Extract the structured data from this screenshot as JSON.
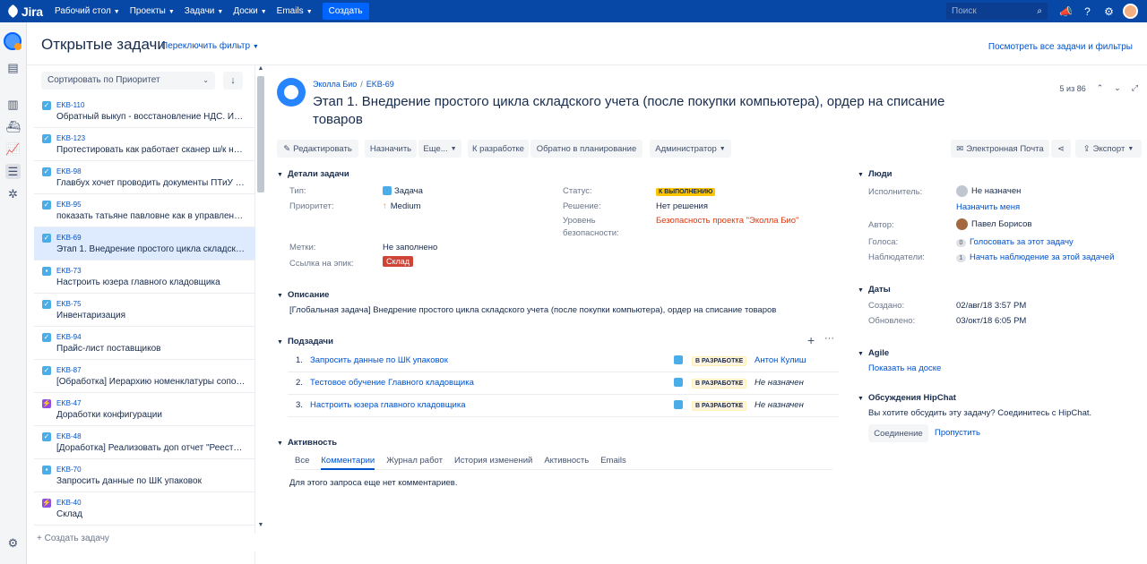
{
  "topnav": {
    "logo": "Jira",
    "items": [
      "Рабочий стол",
      "Проекты",
      "Задачи",
      "Доски",
      "Emails"
    ],
    "create": "Создать",
    "search_placeholder": "Поиск"
  },
  "header": {
    "title": "Открытые задачи",
    "switch_filter": "Переключить фильтр",
    "view_all": "Посмотреть все задачи и фильтры"
  },
  "list": {
    "sort_label": "Сортировать по Приоритет",
    "rows": [
      {
        "key": "EKB-110",
        "summary": "Обратный выкуп - восстановление НДС. Испо...",
        "type": "task"
      },
      {
        "key": "EKB-123",
        "summary": "Протестировать как работает сканер ш/к на ск...",
        "type": "task"
      },
      {
        "key": "EKB-98",
        "summary": "Главбух хочет проводить документы ПТиУ буд...",
        "type": "task"
      },
      {
        "key": "EKB-95",
        "summary": "показать татьяне павловне как в управленческ...",
        "type": "task"
      },
      {
        "key": "EKB-69",
        "summary": "Этап 1. Внедрение простого цикла складского ...",
        "type": "task"
      },
      {
        "key": "EKB-73",
        "summary": "Настроить юзера главного кладовщика",
        "type": "sub"
      },
      {
        "key": "EKB-75",
        "summary": "Инвентаризация",
        "type": "task"
      },
      {
        "key": "EKB-94",
        "summary": "Прайс-лист поставщиков",
        "type": "task"
      },
      {
        "key": "EKB-87",
        "summary": "[Обработка] Иерархию номенклатуры сопоста...",
        "type": "task"
      },
      {
        "key": "EKB-47",
        "summary": "Доработки конфигурации",
        "type": "epic"
      },
      {
        "key": "EKB-48",
        "summary": "[Доработка] Реализовать доп отчет \"Реестр се...",
        "type": "task"
      },
      {
        "key": "EKB-70",
        "summary": "Запросить данные по ШК упаковок",
        "type": "sub"
      },
      {
        "key": "EKB-40",
        "summary": "Склад",
        "type": "epic"
      }
    ],
    "create_task": "+ Создать задачу"
  },
  "issue": {
    "project": "Эколла Био",
    "key": "EKB-69",
    "title": "Этап 1. Внедрение простого цикла складского учета (после покупки компьютера), ордер на списание товаров",
    "pager": "5 из 86",
    "toolbar": {
      "edit": "Редактировать",
      "assign": "Назначить",
      "more": "Еще...",
      "to_dev": "К разработке",
      "back_plan": "Обратно в планирование",
      "admin": "Администратор",
      "email": "Электронная Почта",
      "export": "Экспорт"
    },
    "details": {
      "heading": "Детали задачи",
      "type_label": "Тип:",
      "type_value": "Задача",
      "priority_label": "Приоритет:",
      "priority_value": "Medium",
      "status_label": "Статус:",
      "status_value": "К ВЫПОЛНЕНИЮ",
      "resolution_label": "Решение:",
      "resolution_value": "Нет решения",
      "security_label_1": "Уровень",
      "security_label_2": "безопасности:",
      "security_value": "Безопасность проекта \"Эколла Био\"",
      "labels_label": "Метки:",
      "labels_value": "Не заполнено",
      "epic_label": "Ссылка на эпик:",
      "epic_value": "Склад"
    },
    "description": {
      "heading": "Описание",
      "text": "[Глобальная задача] Внедрение простого цикла складского учета (после покупки компьютера), ордер на списание товаров"
    },
    "subtasks": {
      "heading": "Подзадачи",
      "rows": [
        {
          "n": "1.",
          "title": "Запросить данные по ШК упаковок",
          "status": "В РАЗРАБОТКЕ",
          "assignee": "Антон Кулиш"
        },
        {
          "n": "2.",
          "title": "Тестовое обучение Главного кладовщика",
          "status": "В РАЗРАБОТКЕ",
          "assignee": "Не назначен"
        },
        {
          "n": "3.",
          "title": "Настроить юзера главного кладовщика",
          "status": "В РАЗРАБОТКЕ",
          "assignee": "Не назначен"
        }
      ]
    },
    "activity": {
      "heading": "Активность",
      "tabs": [
        "Все",
        "Комментарии",
        "Журнал работ",
        "История изменений",
        "Активность",
        "Emails"
      ],
      "empty": "Для этого запроса еще нет комментариев."
    }
  },
  "side": {
    "people": {
      "heading": "Люди",
      "assignee_label": "Исполнитель:",
      "assignee_value": "Не назначен",
      "assign_me": "Назначить меня",
      "author_label": "Автор:",
      "author_value": "Павел Борисов",
      "votes_label": "Голоса:",
      "votes_count": "0",
      "votes_link": "Голосовать за этот задачу",
      "watchers_label": "Наблюдатели:",
      "watchers_count": "1",
      "watchers_link": "Начать наблюдение за этой задачей"
    },
    "dates": {
      "heading": "Даты",
      "created_label": "Создано:",
      "created_value": "02/авг/18 3:57 PM",
      "updated_label": "Обновлено:",
      "updated_value": "03/окт/18 6:05 PM"
    },
    "agile": {
      "heading": "Agile",
      "link": "Показать на доске"
    },
    "hipchat": {
      "heading": "Обсуждения HipChat",
      "text": "Вы хотите обсудить эту задачу? Соединитесь с HipChat.",
      "connect": "Соединение",
      "skip": "Пропустить"
    }
  }
}
